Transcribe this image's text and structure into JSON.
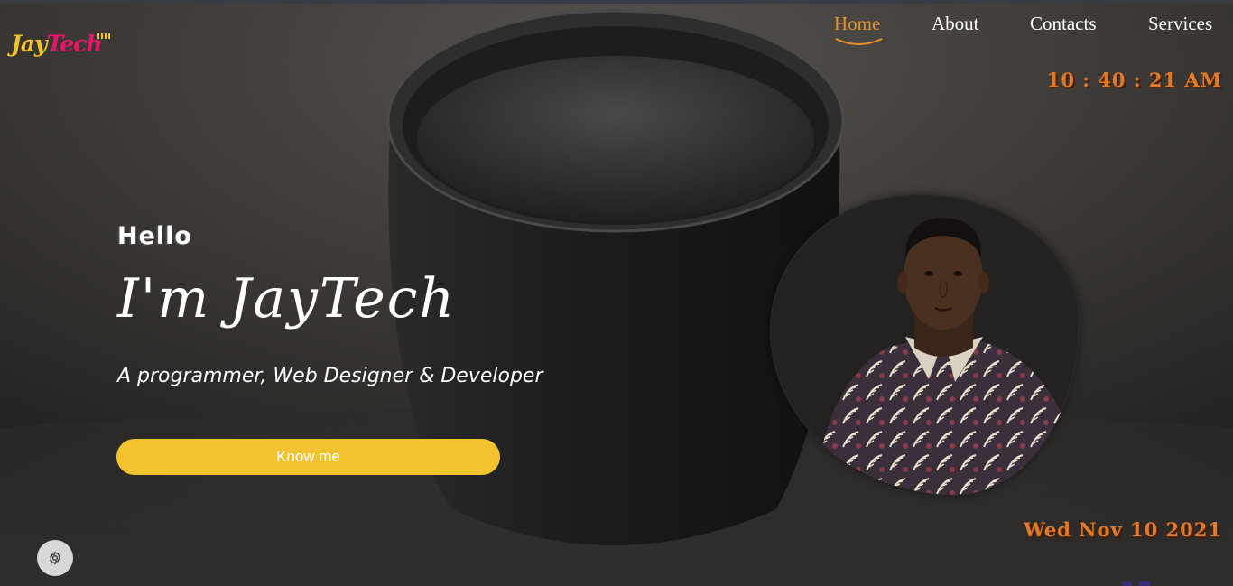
{
  "logo": {
    "part1": "Jay",
    "part2": "Tech"
  },
  "nav": {
    "items": [
      {
        "label": "Home",
        "active": true
      },
      {
        "label": "About",
        "active": false
      },
      {
        "label": "Contacts",
        "active": false
      },
      {
        "label": "Services",
        "active": false
      }
    ]
  },
  "clock": {
    "time": "10 : 40 : 21 AM"
  },
  "date": {
    "text": "Wed Nov 10 2021"
  },
  "hero": {
    "greeting": "Hello",
    "name": "I'm JayTech",
    "tagline": "A programmer, Web Designer & Developer",
    "cta_label": "Know me"
  },
  "icons": {
    "settings": "gear-icon",
    "portrait": "profile-photo"
  },
  "colors": {
    "accent": "#f2c32e",
    "nav_active": "#e8922e",
    "clock": "#e07a2a",
    "logo_pink": "#e8156b"
  }
}
